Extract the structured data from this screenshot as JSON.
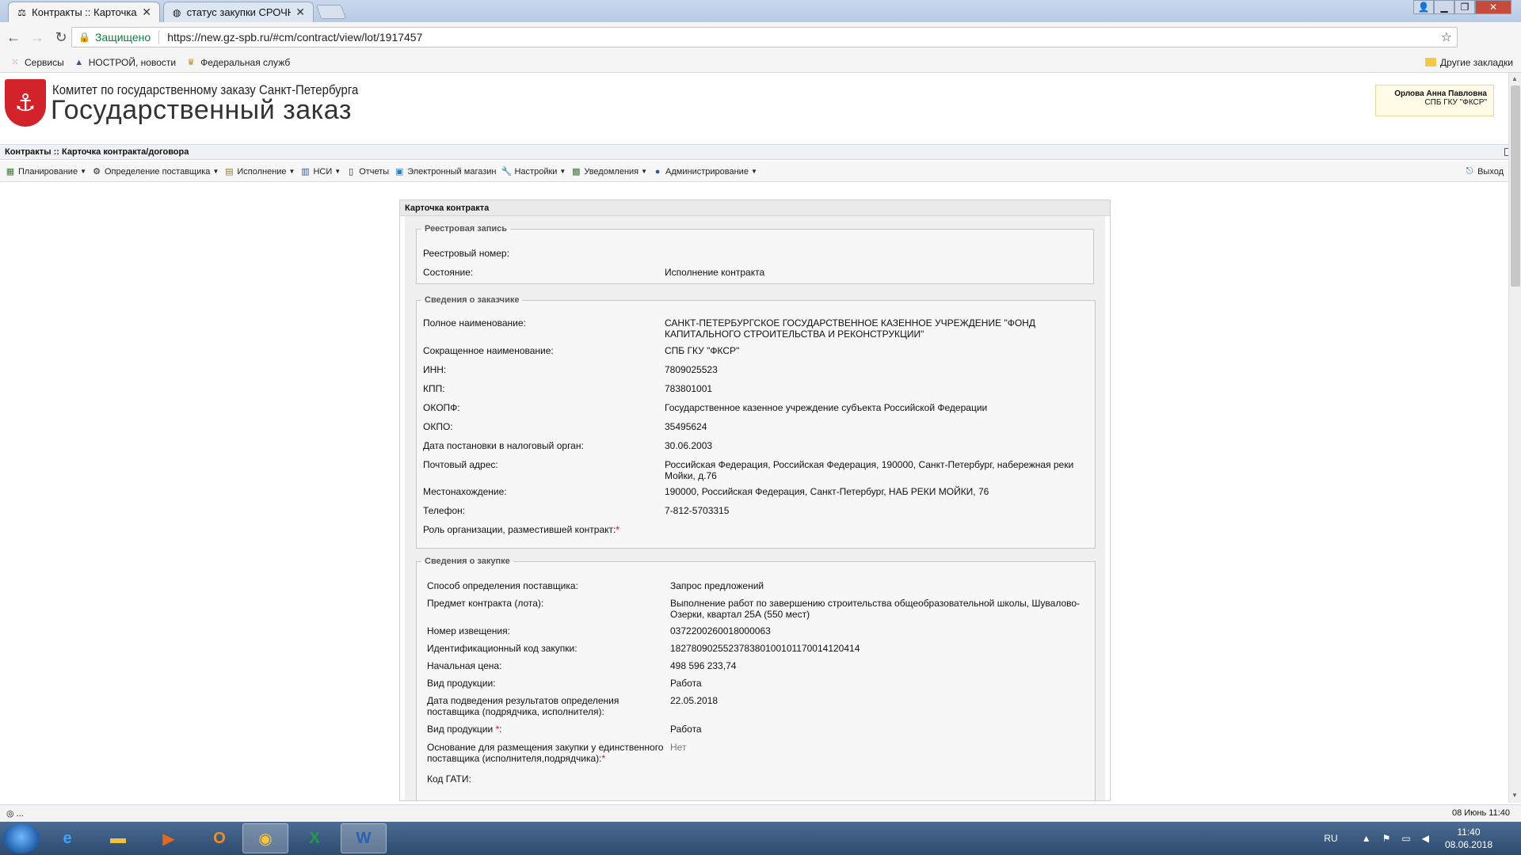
{
  "browser": {
    "tabs": [
      {
        "title": "Контракты :: Карточка к",
        "active": true
      },
      {
        "title": "статус закупки СРОЧНО",
        "active": false
      }
    ],
    "security_label": "Защищено",
    "url": "https://new.gz-spb.ru/#cm/contract/view/lot/1917457",
    "bookmarks": [
      "Сервисы",
      "НОСТРОЙ, новости",
      "Федеральная служб"
    ],
    "other_bookmarks": "Другие закладки"
  },
  "app": {
    "org_name": "Комитет по государственному заказу Санкт-Петербурга",
    "brand": "Государственный заказ",
    "user_name": "Орлова Анна Павловна",
    "user_org": "СПБ ГКУ \"ФКСР\"",
    "breadcrumb": "Контракты :: Карточка контракта/договора",
    "menu": [
      "Планирование",
      "Определение поставщика",
      "Исполнение",
      "НСИ",
      "Отчеты",
      "Электронный магазин",
      "Настройки",
      "Уведомления",
      "Администрирование"
    ],
    "exit_label": "Выход"
  },
  "card": {
    "title": "Карточка контракта",
    "registry": {
      "legend": "Реестровая запись",
      "rows": [
        {
          "label": "Реестровый номер:",
          "value": ""
        },
        {
          "label": "Состояние:",
          "value": "Исполнение контракта"
        }
      ]
    },
    "customer": {
      "legend": "Сведения о заказчике",
      "rows": [
        {
          "label": "Полное наименование:",
          "value": "САНКТ-ПЕТЕРБУРГСКОЕ ГОСУДАРСТВЕННОЕ КАЗЕННОЕ УЧРЕЖДЕНИЕ \"ФОНД КАПИТАЛЬНОГО СТРОИТЕЛЬСТВА И РЕКОНСТРУКЦИИ\""
        },
        {
          "label": "Сокращенное наименование:",
          "value": "СПБ ГКУ \"ФКСР\""
        },
        {
          "label": "ИНН:",
          "value": "7809025523"
        },
        {
          "label": "КПП:",
          "value": "783801001"
        },
        {
          "label": "ОКОПФ:",
          "value": "Государственное казенное учреждение субъекта Российской Федерации"
        },
        {
          "label": "ОКПО:",
          "value": "35495624"
        },
        {
          "label": "Дата постановки в налоговый орган:",
          "value": "30.06.2003"
        },
        {
          "label": "Почтовый адрес:",
          "value": "Российская Федерация, Российская Федерация, 190000, Санкт-Петербург, набережная реки Мойки, д.76"
        },
        {
          "label": "Местонахождение:",
          "value": "190000, Российская Федерация, Санкт-Петербург, НАБ РЕКИ МОЙКИ, 76"
        },
        {
          "label": "Телефон:",
          "value": "7-812-5703315"
        },
        {
          "label": "Роль организации, разместившей контракт:",
          "value": ""
        }
      ]
    },
    "purchase": {
      "legend": "Сведения о закупке",
      "rows": [
        {
          "label": "Способ определения поставщика:",
          "value": "Запрос предложений"
        },
        {
          "label": "Предмет контракта (лота):",
          "value": "Выполнение работ по завершению строительства общеобразовательной школы, Шувалово-Озерки, квартал 25А (550 мест)"
        },
        {
          "label": "Номер извещения:",
          "value": "0372200260018000063"
        },
        {
          "label": "Идентификационный код закупки:",
          "value": "182780902552378380100101170014120414"
        },
        {
          "label": "Начальная цена:",
          "value": "498 596 233,74"
        },
        {
          "label": "Вид продукции:",
          "value": "Работа"
        },
        {
          "label": "Дата подведения результатов определения поставщика (подрядчика, исполнителя):",
          "value": "22.05.2018"
        },
        {
          "label": "Вид продукции",
          "value": "Работа"
        },
        {
          "label": "Основание для размещения закупки у единственного поставщика (исполнителя,подрядчика):",
          "value": "Нет"
        },
        {
          "label": "Код ГАТИ:",
          "value": ""
        }
      ]
    }
  },
  "statusbar": {
    "left": "...",
    "right": "08 Июнь 11:40"
  },
  "taskbar": {
    "lang": "RU",
    "time": "11:40",
    "date": "08.06.2018"
  },
  "colors": {
    "crest_red": "#d2232a",
    "required": "#dd1111",
    "taskbar": "#2d4a6f"
  }
}
